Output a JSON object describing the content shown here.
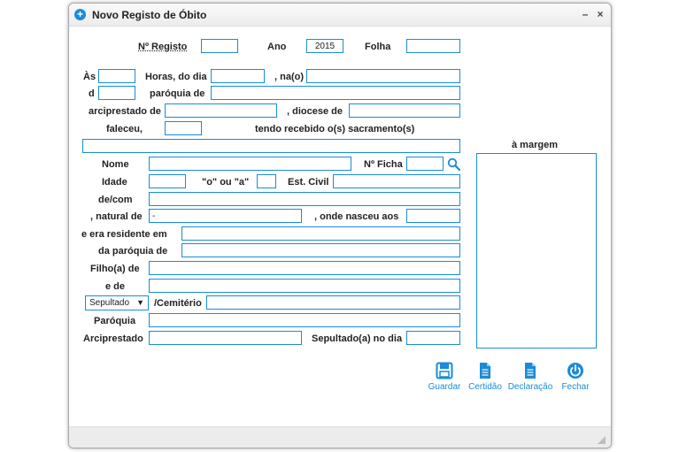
{
  "window": {
    "title": "Novo Registo de Óbito",
    "minimize": "–",
    "close": "×"
  },
  "header": {
    "nr_registo_label": "Nº Registo",
    "ano_label": "Ano",
    "ano_value": "2015",
    "folha_label": "Folha"
  },
  "labels": {
    "as": "Às",
    "horas_do_dia": "Horas, do dia",
    "na": ", na(o)",
    "d": "d",
    "paroquia_de": "paróquia de",
    "arciprestado_de": "arciprestado de",
    "diocese_de": ", diocese de",
    "faleceu": "faleceu,",
    "tendo_recebido": "tendo recebido o(s) sacramento(s)",
    "a_margem": "à margem",
    "nome": "Nome",
    "nr_ficha": "Nº Ficha",
    "idade": "Idade",
    "o_ou_a": "\"o\" ou \"a\"",
    "est_civil": "Est. Civil",
    "de_com": "de/com",
    "natural_de": ", natural de",
    "onde_nasceu_aos": ", onde nasceu aos",
    "era_residente_em": "e era residente em",
    "da_paroquia_de": "da paróquia de",
    "filho_de": "Filho(a) de",
    "e_de": "e de",
    "cemiterio": "/Cemitério",
    "paroquia": "Paróquia",
    "arciprestado": "Arciprestado",
    "sepultado_no_dia": "Sepultado(a) no dia"
  },
  "fields": {
    "natural_de_value": "-"
  },
  "select": {
    "sepultado_value": "Sepultado",
    "arrow": "▼"
  },
  "actions": {
    "guardar": "Guardar",
    "certidao": "Certidão",
    "declaracao": "Declaração",
    "fechar": "Fechar"
  },
  "colors": {
    "accent": "#1a8bd8",
    "border": "#1a8bd8"
  }
}
